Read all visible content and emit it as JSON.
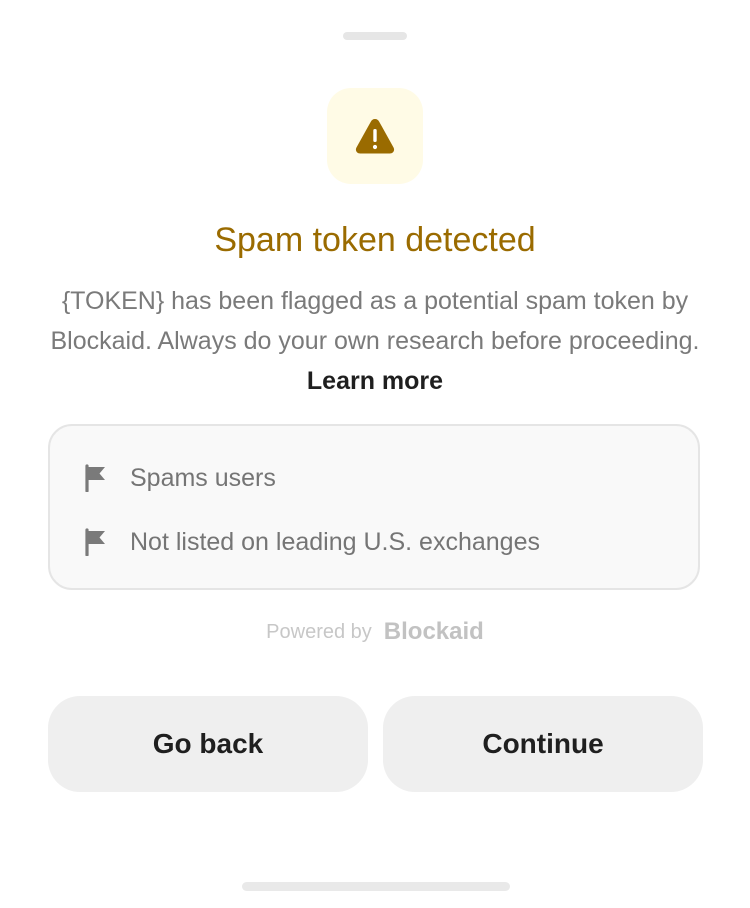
{
  "sheet": {
    "title": "Spam token detected",
    "description": "{TOKEN} has been flagged as a potential spam token by Blockaid. Always do your own research before proceeding.",
    "learn_more_label": "Learn more",
    "warning_icon": "warning-triangle-icon"
  },
  "reasons": [
    {
      "icon": "flag-icon",
      "label": "Spams users"
    },
    {
      "icon": "flag-icon",
      "label": "Not listed on leading U.S. exchanges"
    }
  ],
  "footer": {
    "powered_by_label": "Powered by",
    "brand_name": "Blockaid"
  },
  "actions": {
    "back_label": "Go back",
    "continue_label": "Continue"
  },
  "colors": {
    "warning_text": "#9a6b00",
    "warning_tile_bg": "#fffbe6",
    "button_bg": "#efefef"
  }
}
